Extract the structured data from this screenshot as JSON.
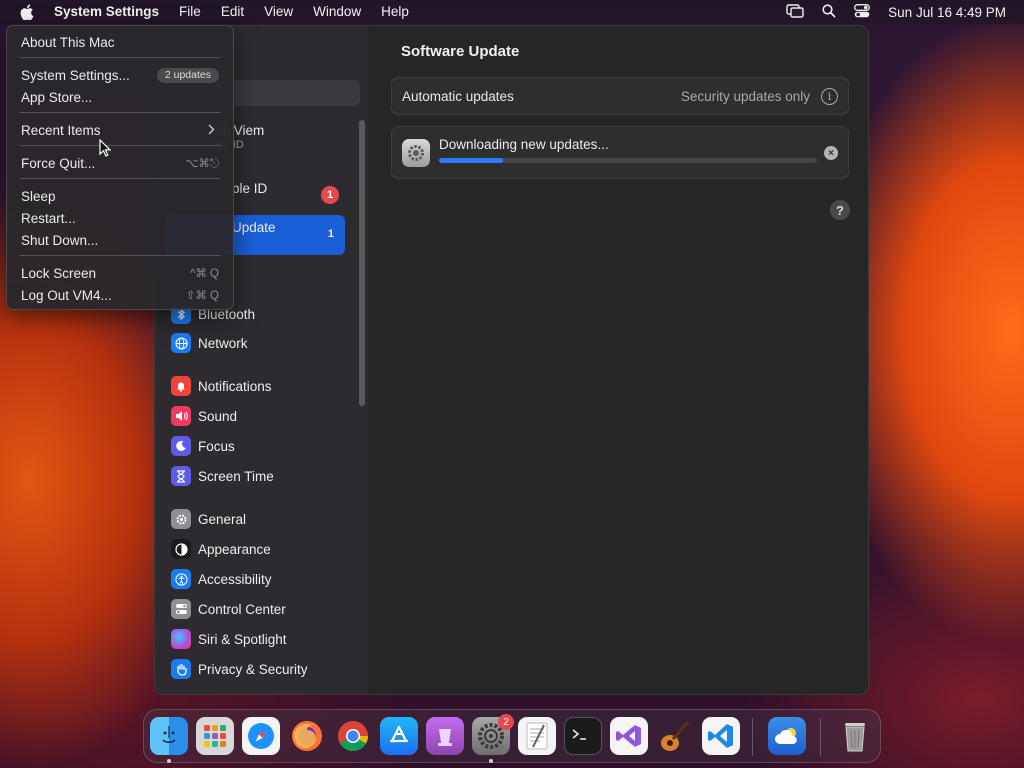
{
  "menubar": {
    "apple_icon": "apple-logo-icon",
    "app_name": "System Settings",
    "menus": [
      "File",
      "Edit",
      "View",
      "Window",
      "Help"
    ],
    "status_icons": [
      "screen-mirroring-icon",
      "spotlight-search-icon",
      "control-center-icon"
    ],
    "clock": "Sun Jul 16  4:49 PM"
  },
  "apple_menu": {
    "items": [
      {
        "label": "About This Mac"
      },
      {
        "label": "System Settings...",
        "badge": "2 updates"
      },
      {
        "label": "App Store..."
      },
      {
        "label": "Recent Items",
        "submenu": true
      },
      {
        "label": "Force Quit...",
        "shortcut": "⌥⌘⎋"
      },
      {
        "label": "Sleep"
      },
      {
        "label": "Restart..."
      },
      {
        "label": "Shut Down..."
      },
      {
        "label": "Lock Screen",
        "shortcut": "^⌘ Q"
      },
      {
        "label": "Log Out VM4...",
        "shortcut": "⇧⌘ Q"
      }
    ]
  },
  "sidebar": {
    "account_name": "ub Viem",
    "account_sub": "ple ID",
    "apple_id_label": "ple ID",
    "apple_id_badge": "1",
    "selected_label": "Update",
    "selected_badge": "1",
    "items": [
      {
        "label": "Bluetooth",
        "icon": "bluetooth-icon",
        "color": "#1a7cf5"
      },
      {
        "label": "Network",
        "icon": "network-globe-icon",
        "color": "#1a7cf5"
      },
      {
        "label": "Notifications",
        "icon": "notifications-bell-icon",
        "color": "#f0443a"
      },
      {
        "label": "Sound",
        "icon": "sound-speaker-icon",
        "color": "#f03a5f"
      },
      {
        "label": "Focus",
        "icon": "focus-moon-icon",
        "color": "#5e5ce6"
      },
      {
        "label": "Screen Time",
        "icon": "screen-time-hourglass-icon",
        "color": "#5e5ce6"
      },
      {
        "label": "General",
        "icon": "general-gear-icon",
        "color": "#8e8e93"
      },
      {
        "label": "Appearance",
        "icon": "appearance-circle-icon",
        "color": "#1c1c1e"
      },
      {
        "label": "Accessibility",
        "icon": "accessibility-person-icon",
        "color": "#1a7cf5"
      },
      {
        "label": "Control Center",
        "icon": "control-center-toggles-icon",
        "color": "#8e8e93"
      },
      {
        "label": "Siri & Spotlight",
        "icon": "siri-orb-icon",
        "color": "#b84ad6"
      },
      {
        "label": "Privacy & Security",
        "icon": "privacy-hand-icon",
        "color": "#1a7cf5"
      }
    ]
  },
  "main": {
    "title": "Software Update",
    "auto_updates_label": "Automatic updates",
    "auto_updates_value": "Security updates only",
    "info_glyph": "i",
    "downloading_label": "Downloading new updates...",
    "progress": 0.17,
    "cancel_glyph": "×",
    "help_glyph": "?"
  },
  "dock": {
    "apps": [
      {
        "name": "Finder",
        "icon": "finder-icon",
        "running": true
      },
      {
        "name": "Launchpad",
        "icon": "launchpad-icon"
      },
      {
        "name": "Safari",
        "icon": "safari-compass-icon"
      },
      {
        "name": "Firefox",
        "icon": "firefox-icon"
      },
      {
        "name": "Chrome",
        "icon": "chrome-icon"
      },
      {
        "name": "App Store",
        "icon": "app-store-icon"
      },
      {
        "name": "Podcasts",
        "icon": "podcasts-icon"
      },
      {
        "name": "System Settings",
        "icon": "system-settings-gear-icon",
        "badge": "2",
        "running": true
      },
      {
        "name": "TextEdit",
        "icon": "textedit-icon"
      },
      {
        "name": "Terminal",
        "icon": "terminal-icon"
      },
      {
        "name": "Visual Studio",
        "icon": "visual-studio-icon"
      },
      {
        "name": "GarageBand",
        "icon": "garageband-guitar-icon"
      },
      {
        "name": "VS Code",
        "icon": "vscode-icon"
      },
      {
        "name": "Weather",
        "icon": "weather-cloud-icon"
      },
      {
        "name": "Trash",
        "icon": "trash-icon"
      }
    ]
  }
}
